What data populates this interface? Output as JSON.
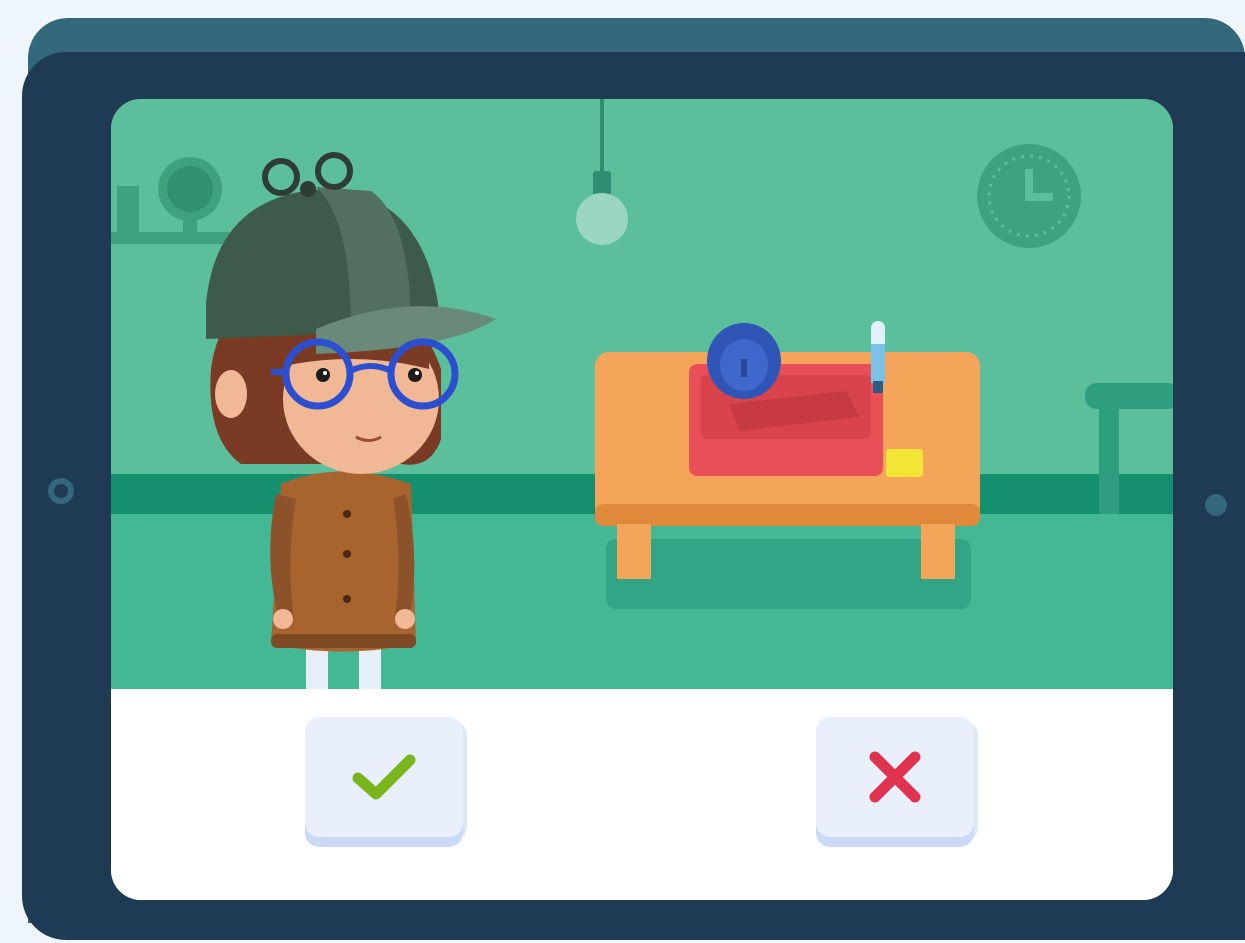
{
  "game": {
    "screen": "detective-observation-scene",
    "scene_elements": {
      "character": "detective-girl",
      "props": [
        "hanging-light-bulb",
        "wall-clock",
        "globe-on-shelf",
        "table",
        "hamster-cage",
        "exercise-wheel",
        "water-bottle",
        "yellow-block",
        "side-table"
      ]
    },
    "answer_buttons": {
      "yes_icon": "checkmark-icon",
      "no_icon": "cross-icon"
    }
  },
  "colors": {
    "tablet_frame": "#1f3a53",
    "tablet_back": "#33677a",
    "wall": "#5bbf9b",
    "floor": "#44b894",
    "check_green": "#7ab51d",
    "cross_red": "#e0334f",
    "button_face": "#e9f0fb"
  }
}
